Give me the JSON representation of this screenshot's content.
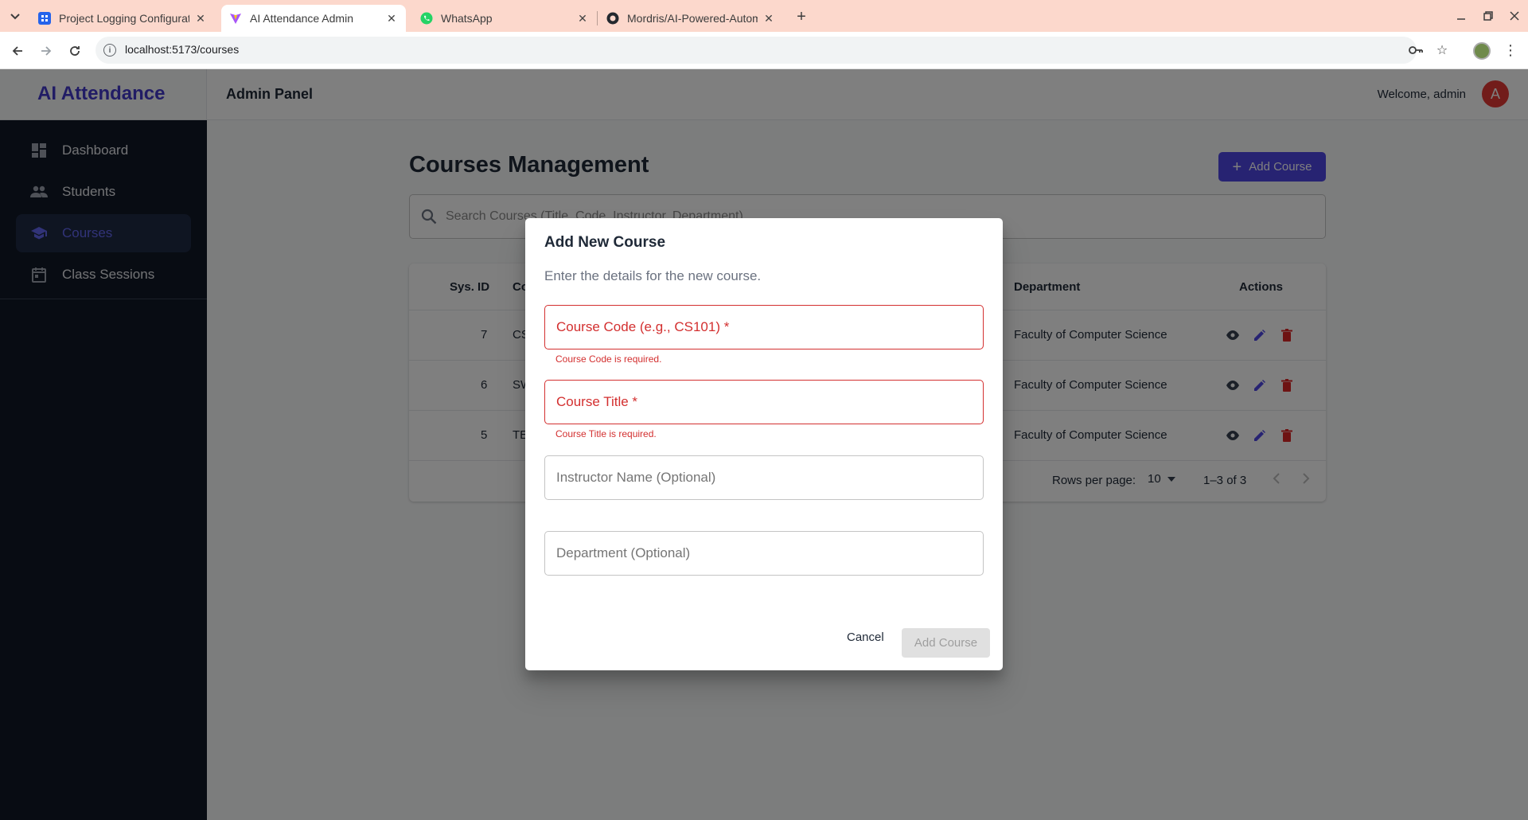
{
  "browser": {
    "tabs": [
      {
        "title": "Project Logging Configuratio",
        "icon": "jira-icon"
      },
      {
        "title": "AI Attendance Admin",
        "icon": "vite-icon"
      },
      {
        "title": "WhatsApp",
        "icon": "whatsapp-icon"
      },
      {
        "title": "Mordris/AI-Powered-Autom",
        "icon": "github-icon"
      }
    ],
    "url": "localhost:5173/courses"
  },
  "sidebar": {
    "brand": "AI Attendance",
    "items": [
      {
        "label": "Dashboard",
        "icon": "dashboard-icon"
      },
      {
        "label": "Students",
        "icon": "people-icon"
      },
      {
        "label": "Courses",
        "icon": "school-icon",
        "active": true
      },
      {
        "label": "Class Sessions",
        "icon": "calendar-icon"
      }
    ]
  },
  "header": {
    "title": "Admin Panel",
    "welcome": "Welcome, admin",
    "avatar_letter": "A"
  },
  "main": {
    "title": "Courses Management",
    "add_button": "Add Course",
    "search_placeholder": "Search Courses (Title, Code, Instructor, Department)",
    "table": {
      "headers": {
        "id": "Sys. ID",
        "code": "Co",
        "department": "Department",
        "actions": "Actions"
      },
      "rows": [
        {
          "id": "7",
          "code": "CS",
          "department": "Faculty of Computer Science"
        },
        {
          "id": "6",
          "code": "SW",
          "department": "Faculty of Computer Science"
        },
        {
          "id": "5",
          "code": "TE",
          "department": "Faculty of Computer Science"
        }
      ]
    },
    "pagination": {
      "rows_label": "Rows per page:",
      "rows_value": "10",
      "range": "1–3 of 3"
    }
  },
  "dialog": {
    "title": "Add New Course",
    "subtitle": "Enter the details for the new course.",
    "fields": {
      "code": {
        "label": "Course Code (e.g., CS101) *",
        "error": "Course Code is required."
      },
      "title": {
        "label": "Course Title *",
        "error": "Course Title is required."
      },
      "instructor": {
        "label": "Instructor Name (Optional)"
      },
      "department": {
        "label": "Department (Optional)"
      }
    },
    "cancel": "Cancel",
    "submit": "Add Course"
  },
  "colors": {
    "brand": "#4338ca",
    "primary": "#4f46e5",
    "error": "#d32f2f",
    "sidebar_bg": "#111827",
    "tab_strip": "#fcd8cc"
  }
}
